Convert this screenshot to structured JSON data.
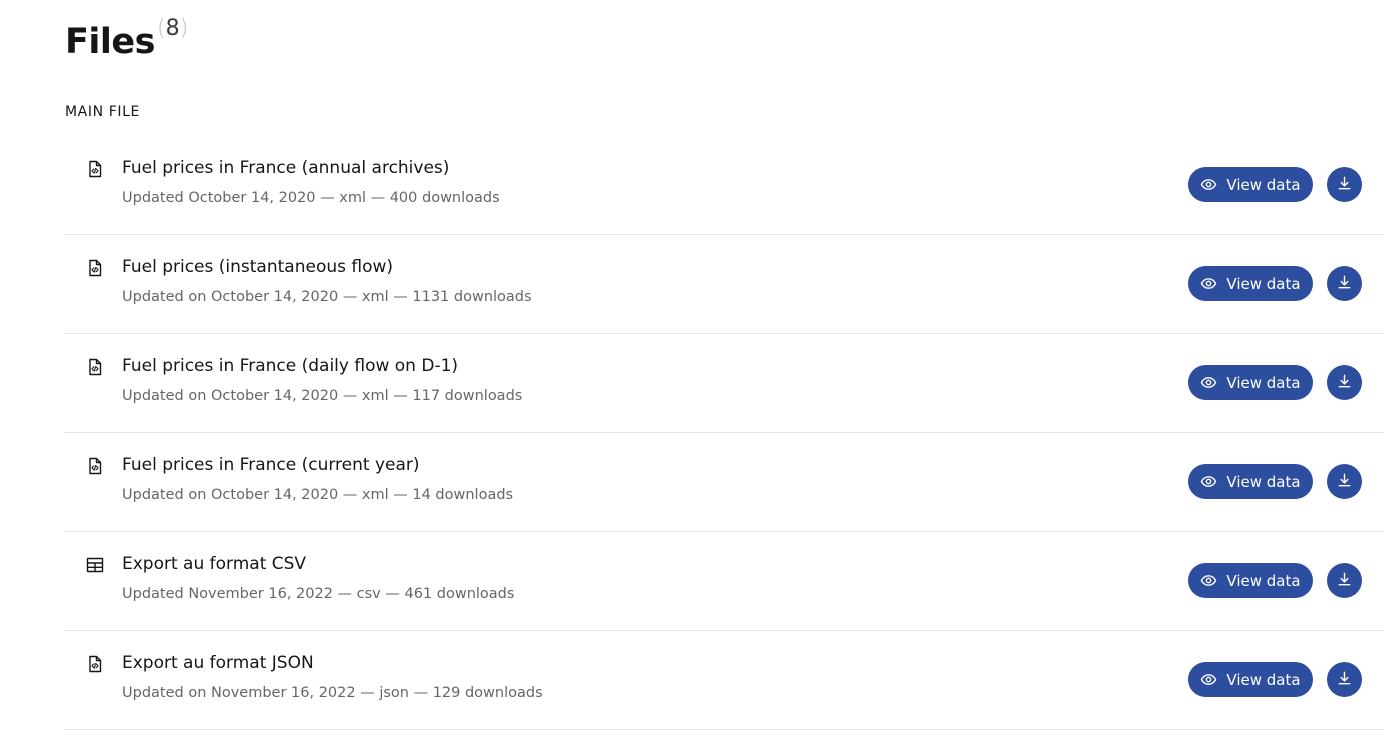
{
  "header": {
    "title": "Files",
    "count": "8"
  },
  "section": {
    "label": "MAIN FILE"
  },
  "files": [
    {
      "icon": "code-file-icon",
      "title": "Fuel prices in France (annual archives)",
      "meta": "Updated October 14, 2020 — xml — 400 downloads",
      "view_label": "View data"
    },
    {
      "icon": "code-file-icon",
      "title": "Fuel prices (instantaneous flow)",
      "meta": "Updated on October 14, 2020 — xml — 1131 downloads",
      "view_label": "View data"
    },
    {
      "icon": "code-file-icon",
      "title": "Fuel prices in France (daily flow on D-1)",
      "meta": "Updated on October 14, 2020 — xml — 117 downloads",
      "view_label": "View data"
    },
    {
      "icon": "code-file-icon",
      "title": "Fuel prices in France (current year)",
      "meta": "Updated on October 14, 2020 — xml — 14 downloads",
      "view_label": "View data"
    },
    {
      "icon": "table-icon",
      "title": "Export au format CSV",
      "meta": "Updated November 16, 2022 — csv — 461 downloads",
      "view_label": "View data"
    },
    {
      "icon": "code-file-icon",
      "title": "Export au format JSON",
      "meta": "Updated on November 16, 2022 — json — 129 downloads",
      "view_label": "View data"
    }
  ],
  "colors": {
    "primary": "#2d4d9e",
    "text": "#161616",
    "muted": "#666666",
    "divider": "#e5e5e5"
  }
}
